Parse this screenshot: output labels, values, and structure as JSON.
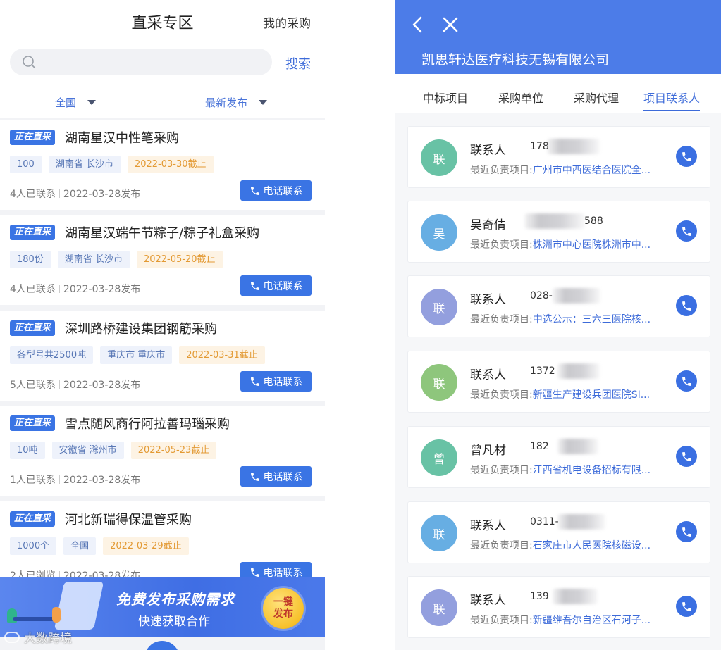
{
  "left_panel": {
    "title": "直采专区",
    "my_purchase": "我的采购",
    "search": {
      "placeholder": "",
      "button": "搜索"
    },
    "filters": {
      "region": "全国",
      "sort": "最新发布"
    },
    "badge_label": "正在直采",
    "call_label": "电话联系",
    "items": [
      {
        "title": "湖南星汉中性笔采购",
        "qty": "100",
        "location": "湖南省 长沙市",
        "deadline": "2022-03-30截止",
        "contacts": "4人已联系",
        "published": "2022-03-28发布"
      },
      {
        "title": "湖南星汉端午节粽子/粽子礼盒采购",
        "qty": "180份",
        "location": "湖南省 长沙市",
        "deadline": "2022-05-20截止",
        "contacts": "4人已联系",
        "published": "2022-03-28发布"
      },
      {
        "title": "深圳路桥建设集团钢筋采购",
        "qty": "各型号共2500吨",
        "location": "重庆市 重庆市",
        "deadline": "2022-03-31截止",
        "contacts": "5人已联系",
        "published": "2022-03-28发布"
      },
      {
        "title": "雪点随风商行阿拉善玛瑙采购",
        "qty": "10吨",
        "location": "安徽省 滁州市",
        "deadline": "2022-05-23截止",
        "contacts": "1人已联系",
        "published": "2022-03-28发布"
      },
      {
        "title": "河北新瑞得保温管采购",
        "qty": "1000个",
        "location": "全国",
        "deadline": "2022-03-29截止",
        "contacts": "2人已浏览",
        "published": "2022-03-28发布"
      }
    ],
    "banner": {
      "line1": "免费发布采购需求",
      "line2": "快速获取合作",
      "button_line1": "一键",
      "button_line2": "发布"
    },
    "watermark": "大数跨境"
  },
  "right_panel": {
    "company": "凯思轩达医疗科技无锡有限公司",
    "tabs": [
      "中标项目",
      "采购单位",
      "采购代理",
      "项目联系人"
    ],
    "active_tab": "项目联系人",
    "project_label": "最近负责项目:",
    "contacts": [
      {
        "avatar": "联",
        "color": "#68c2a5",
        "name": "联系人",
        "phone": "178",
        "project": "广州市中西医结合医院全..."
      },
      {
        "avatar": "吴",
        "color": "#67aee3",
        "name": "吴奇倩",
        "phone": "588",
        "project": "株洲市中心医院株洲市中..."
      },
      {
        "avatar": "联",
        "color": "#939fde",
        "name": "联系人",
        "phone": "028-",
        "project": "中选公示：三六三医院核..."
      },
      {
        "avatar": "联",
        "color": "#8ec67c",
        "name": "联系人",
        "phone": "1372",
        "project": "新疆生产建设兵团医院SI..."
      },
      {
        "avatar": "曾",
        "color": "#68c2a5",
        "name": "曾凡材",
        "phone": "182",
        "project": "江西省机电设备招标有限..."
      },
      {
        "avatar": "联",
        "color": "#67aee3",
        "name": "联系人",
        "phone": "0311-",
        "project": "石家庄市人民医院核磁设..."
      },
      {
        "avatar": "联",
        "color": "#939fde",
        "name": "联系人",
        "phone": "139",
        "project": "新疆维吾尔自治区石河子..."
      }
    ]
  }
}
